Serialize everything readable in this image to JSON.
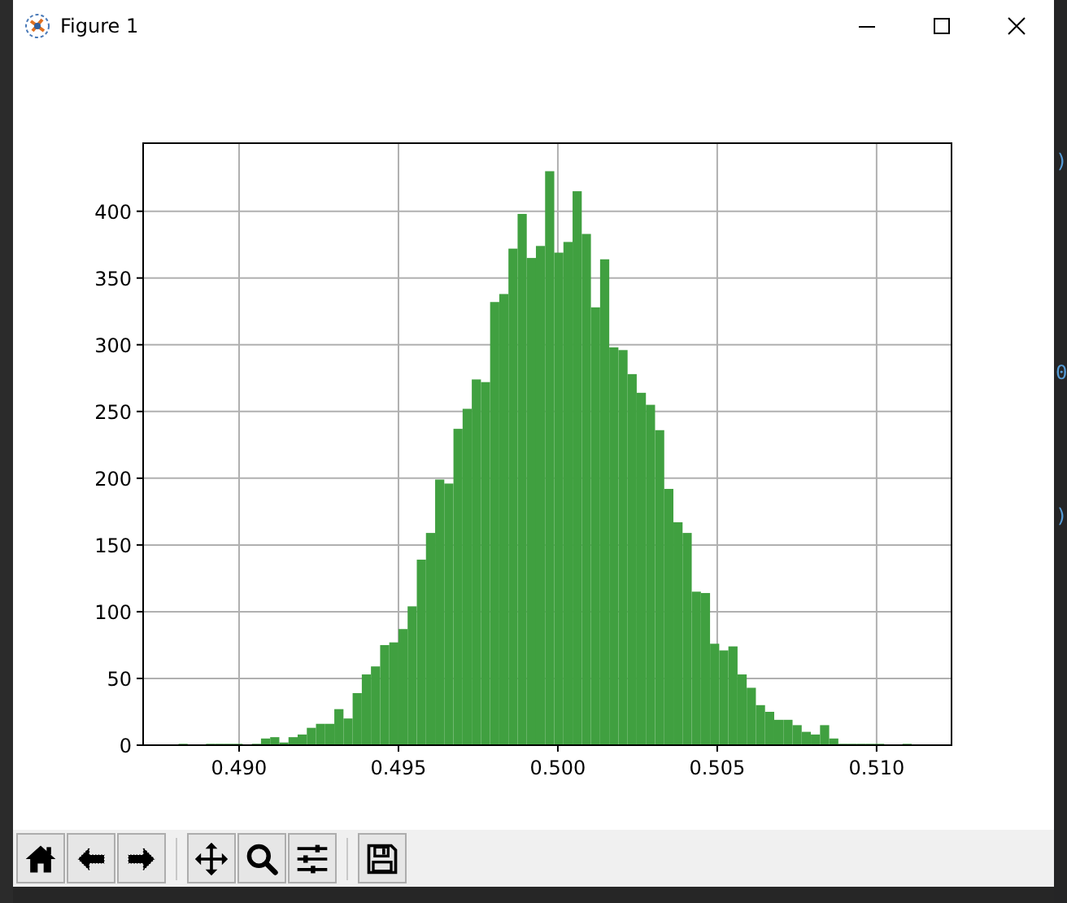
{
  "window": {
    "title": "Figure 1"
  },
  "figure": {
    "chart_data": {
      "type": "bar",
      "x": [
        0.488244,
        0.489106,
        0.489394,
        0.489681,
        0.489969,
        0.490544,
        0.490831,
        0.491119,
        0.491406,
        0.491694,
        0.491981,
        0.492269,
        0.492556,
        0.492844,
        0.493131,
        0.493419,
        0.493706,
        0.493994,
        0.494281,
        0.494569,
        0.494856,
        0.495144,
        0.495431,
        0.495719,
        0.496006,
        0.496294,
        0.496581,
        0.496869,
        0.497156,
        0.497444,
        0.497731,
        0.498019,
        0.498306,
        0.498594,
        0.498881,
        0.499169,
        0.499456,
        0.499744,
        0.500031,
        0.500319,
        0.500606,
        0.500894,
        0.501181,
        0.501469,
        0.501756,
        0.502044,
        0.502331,
        0.502619,
        0.502906,
        0.503194,
        0.503481,
        0.503769,
        0.504056,
        0.504344,
        0.504631,
        0.504919,
        0.505206,
        0.505494,
        0.505781,
        0.506069,
        0.506356,
        0.506644,
        0.506931,
        0.507219,
        0.507506,
        0.507794,
        0.508081,
        0.508369,
        0.508656,
        0.508944,
        0.509231,
        0.509519,
        0.509806,
        0.510094,
        0.510956
      ],
      "series": [
        {
          "color": "#40a040",
          "values": [
            1,
            1,
            1,
            1,
            1,
            1,
            5,
            6,
            2,
            6,
            8,
            13,
            16,
            16,
            27,
            20,
            39,
            53,
            59,
            75,
            77,
            87,
            104,
            139,
            159,
            199,
            196,
            237,
            252,
            274,
            272,
            332,
            338,
            372,
            398,
            365,
            374,
            430,
            369,
            377,
            415,
            383,
            328,
            364,
            298,
            296,
            278,
            264,
            255,
            236,
            192,
            167,
            159,
            115,
            114,
            76,
            71,
            74,
            53,
            43,
            30,
            25,
            19,
            19,
            15,
            10,
            8,
            15,
            5,
            1,
            1,
            1,
            1,
            1,
            1
          ]
        }
      ],
      "xlim": [
        0.48699,
        0.51235
      ],
      "ylim": [
        0,
        451
      ],
      "grid": true,
      "xticks": [
        {
          "value": 0.49,
          "label": "0.490"
        },
        {
          "value": 0.495,
          "label": "0.495"
        },
        {
          "value": 0.5,
          "label": "0.500"
        },
        {
          "value": 0.505,
          "label": "0.505"
        },
        {
          "value": 0.51,
          "label": "0.510"
        }
      ],
      "yticks": [
        0,
        50,
        100,
        150,
        200,
        250,
        300,
        350,
        400
      ]
    }
  },
  "background_text": [
    ")",
    "0",
    ")"
  ]
}
